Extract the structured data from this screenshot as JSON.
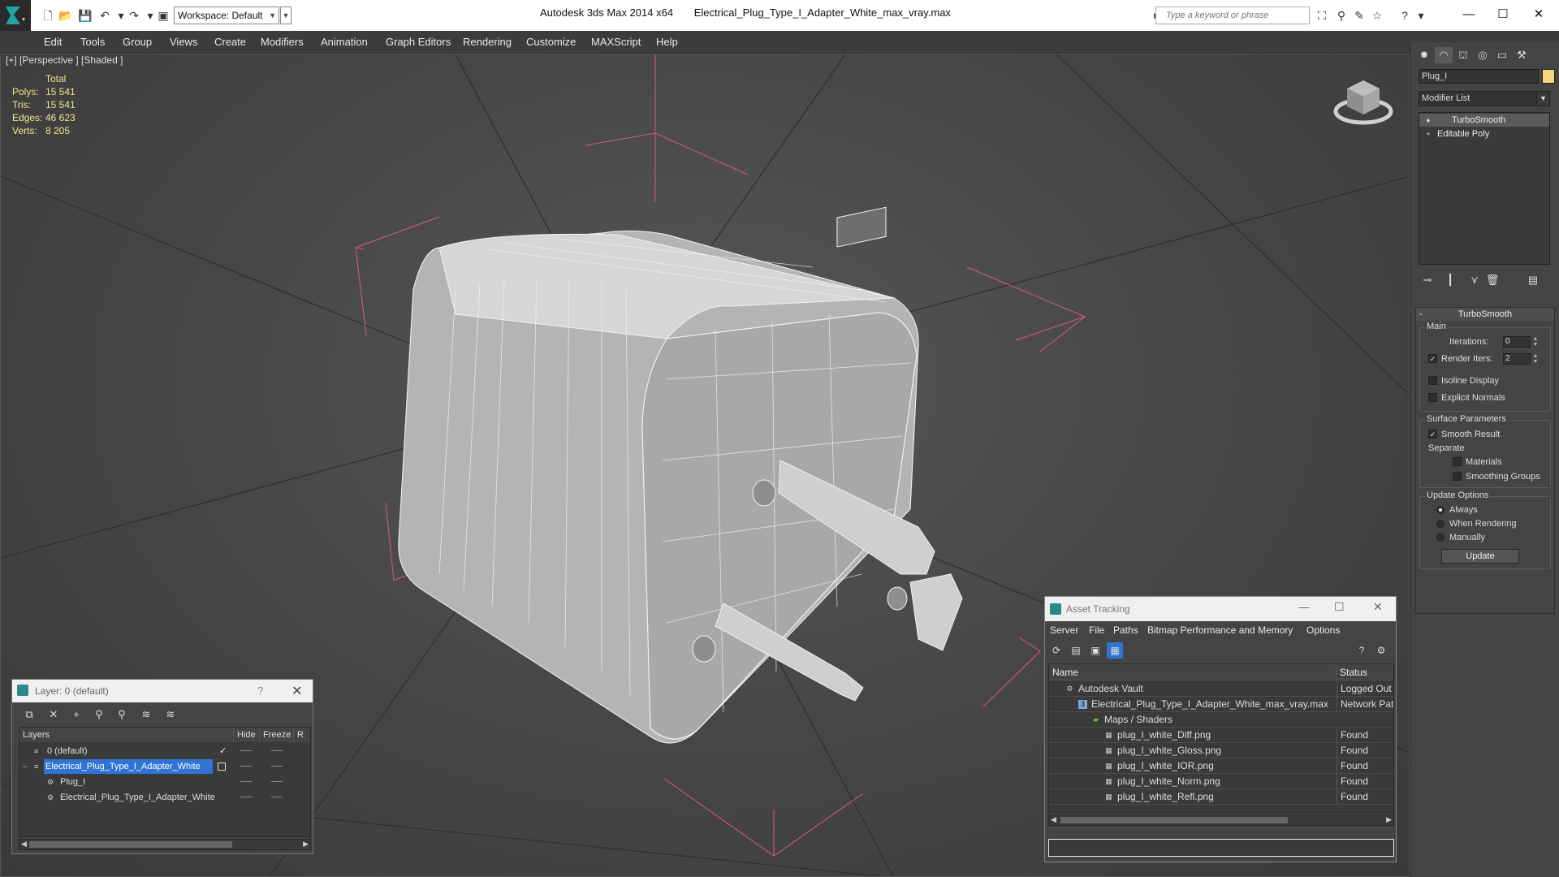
{
  "titlebar": {
    "workspace": "Workspace: Default",
    "app_name": "Autodesk 3ds Max  2014 x64",
    "file_name": "Electrical_Plug_Type_I_Adapter_White_max_vray.max",
    "search_placeholder": "Type a keyword or phrase",
    "minimize": "—",
    "maximize": "☐",
    "close": "✕"
  },
  "menubar": {
    "items": [
      "Edit",
      "Tools",
      "Group",
      "Views",
      "Create",
      "Modifiers",
      "Animation",
      "Graph Editors",
      "Rendering",
      "Customize",
      "MAXScript",
      "Help"
    ]
  },
  "viewport": {
    "label": "[+] [Perspective ] [Shaded ]",
    "stats": {
      "header": "Total",
      "polys_label": "Polys:",
      "polys": "15 541",
      "tris_label": "Tris:",
      "tris": "15 541",
      "edges_label": "Edges:",
      "edges": "46 623",
      "verts_label": "Verts:",
      "verts": "8 205"
    }
  },
  "command_panel": {
    "object_name": "Plug_I",
    "object_color": "#f6d77a",
    "modifier_list": "Modifier List",
    "stack": [
      "TurboSmooth",
      "Editable Poly"
    ],
    "rollout_title": "TurboSmooth",
    "main_group": "Main",
    "iterations_label": "Iterations:",
    "iterations": "0",
    "render_iters_label": "Render Iters:",
    "render_iters": "2",
    "isoline_display": "Isoline Display",
    "explicit_normals": "Explicit Normals",
    "surface_params_group": "Surface Parameters",
    "smooth_result": "Smooth Result",
    "separate_label": "Separate",
    "materials": "Materials",
    "smoothing_groups": "Smoothing Groups",
    "update_options_group": "Update Options",
    "always": "Always",
    "when_rendering": "When Rendering",
    "manually": "Manually",
    "update_button": "Update"
  },
  "layer_dialog": {
    "title": "Layer: 0 (default)",
    "help": "?",
    "close": "✕",
    "columns": [
      "Layers",
      "Hide",
      "Freeze",
      "R"
    ],
    "rows": [
      {
        "name": "0 (default)"
      },
      {
        "name": "Electrical_Plug_Type_I_Adapter_White"
      },
      {
        "name": "Plug_I"
      },
      {
        "name": "Electrical_Plug_Type_I_Adapter_White"
      }
    ]
  },
  "asset_tracking": {
    "title": "Asset Tracking",
    "menu": [
      "Server",
      "File",
      "Paths",
      "Bitmap Performance and Memory",
      "Options"
    ],
    "columns": [
      "Name",
      "Status"
    ],
    "rows": [
      {
        "name": "Autodesk Vault",
        "status": "Logged Out"
      },
      {
        "name": "Electrical_Plug_Type_I_Adapter_White_max_vray.max",
        "status": "Network Pat"
      },
      {
        "name": "Maps / Shaders",
        "status": ""
      },
      {
        "name": "plug_I_white_Diff.png",
        "status": "Found"
      },
      {
        "name": "plug_I_white_Gloss.png",
        "status": "Found"
      },
      {
        "name": "plug_I_white_IOR.png",
        "status": "Found"
      },
      {
        "name": "plug_I_white_Norm.png",
        "status": "Found"
      },
      {
        "name": "plug_I_white_Refl.png",
        "status": "Found"
      }
    ]
  }
}
